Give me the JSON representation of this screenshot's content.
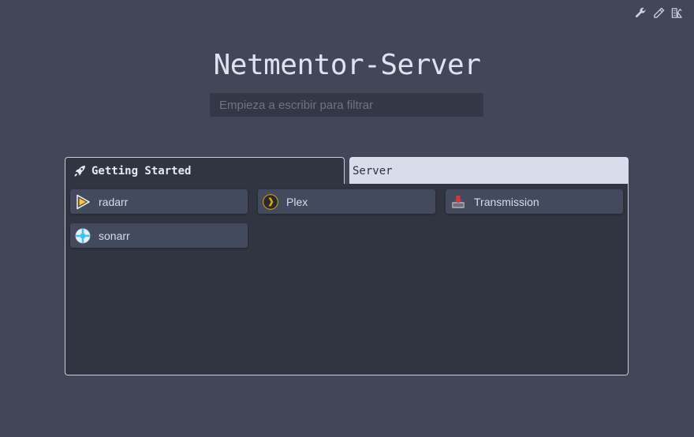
{
  "header": {
    "title": "Netmentor-Server",
    "search_placeholder": "Empieza a escribir para filtrar"
  },
  "toolbar": {
    "icons": [
      "wrench-icon",
      "pencil-icon",
      "layout-icon"
    ]
  },
  "tabs": [
    {
      "label": "Getting Started",
      "active": true,
      "icon": "rocket-icon"
    },
    {
      "label": "Server",
      "active": false
    }
  ],
  "apps": [
    {
      "label": "radarr",
      "icon": "radarr-icon"
    },
    {
      "label": "Plex",
      "icon": "plex-icon"
    },
    {
      "label": "Transmission",
      "icon": "transmission-icon"
    },
    {
      "label": "sonarr",
      "icon": "sonarr-icon"
    }
  ],
  "colors": {
    "background": "#414659",
    "panel": "#313441",
    "tile": "#444a5d",
    "inactive_tab": "#d9dcea",
    "text": "#dfe3f0"
  }
}
